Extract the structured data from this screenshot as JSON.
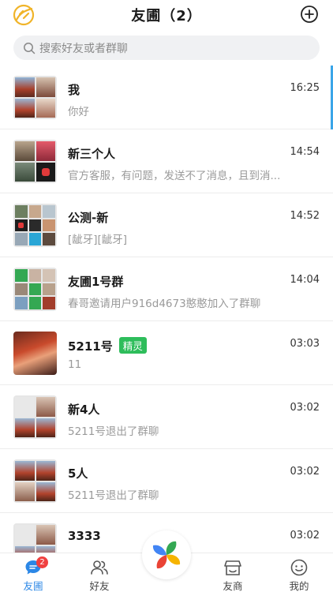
{
  "header": {
    "title": "友圃（2）",
    "logo_icon": "app-logo-icon",
    "add_icon": "plus-circle-icon"
  },
  "search": {
    "placeholder": "搜索好友或者群聊",
    "icon": "search-icon"
  },
  "chats": [
    {
      "name": "我",
      "time": "16:25",
      "message": "你好",
      "tag": ""
    },
    {
      "name": "新三个人",
      "time": "14:54",
      "message": "官方客服，有问题，发送不了消息，且到消...",
      "tag": ""
    },
    {
      "name": "公测-新",
      "time": "14:52",
      "message": "[龇牙][龇牙]",
      "tag": ""
    },
    {
      "name": "友圃1号群",
      "time": "14:04",
      "message": "春哥邀请用户916d4673憨憨加入了群聊",
      "tag": ""
    },
    {
      "name": "5211号",
      "time": "03:03",
      "message": "11",
      "tag": "精灵"
    },
    {
      "name": "新4人",
      "time": "03:02",
      "message": "5211号退出了群聊",
      "tag": ""
    },
    {
      "name": "5人",
      "time": "03:02",
      "message": "5211号退出了群聊",
      "tag": ""
    },
    {
      "name": "3333",
      "time": "03:02",
      "message": "",
      "tag": ""
    }
  ],
  "tabbar": {
    "tabs": [
      {
        "label": "友圃",
        "icon": "chat-bubble-icon",
        "badge": "2",
        "active": true
      },
      {
        "label": "好友",
        "icon": "friends-icon",
        "badge": "",
        "active": false
      },
      {
        "label": "友商",
        "icon": "shop-icon",
        "badge": "",
        "active": false
      },
      {
        "label": "我的",
        "icon": "smiley-face-icon",
        "badge": "",
        "active": false
      }
    ],
    "center_icon": "pinwheel-icon"
  },
  "colors": {
    "accent": "#2b87e6",
    "tag_green": "#2ebd5b",
    "badge_red": "#f04040",
    "active_bar": "#3aa5e8"
  }
}
